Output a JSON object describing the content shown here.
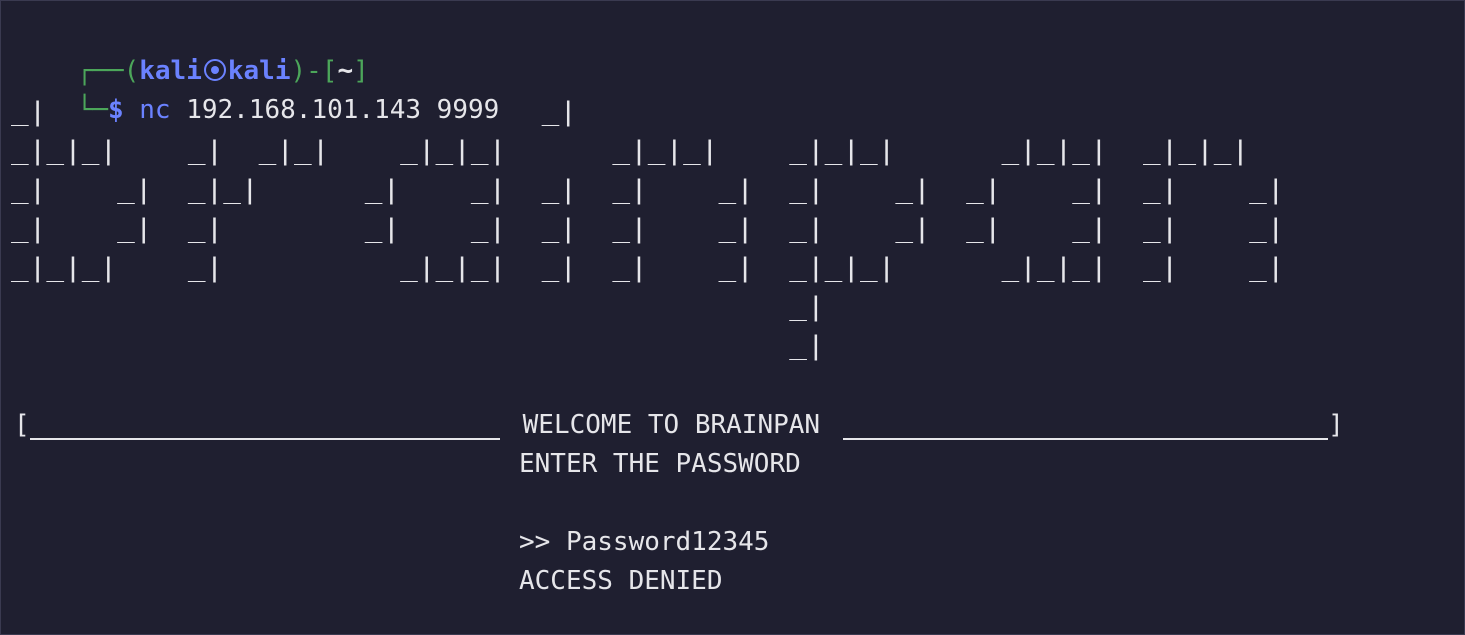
{
  "prompt": {
    "frame_top": "┌──(",
    "user": "kali",
    "host": "kali",
    "dir_open": ")-[",
    "dir": "~",
    "dir_close": "]",
    "frame_bottom": "└─",
    "symbol": "$",
    "command": "nc",
    "args": "192.168.101.143 9999",
    "icon": "kali-skull-icon"
  },
  "banner": {
    "ascii_art": "_|                            _|\n_|_|_|    _|  _|_|    _|_|_|      _|_|_|    _|_|_|      _|_|_|  _|_|_|\n_|    _|  _|_|      _|    _|  _|  _|    _|  _|    _|  _|    _|  _|    _|\n_|    _|  _|        _|    _|  _|  _|    _|  _|    _|  _|    _|  _|    _|\n_|_|_|    _|          _|_|_|  _|  _|    _|  _|_|_|      _|_|_|  _|    _|\n                                            _|\n                                            _|",
    "bracket_left": "[",
    "welcome": "WELCOME TO BRAINPAN",
    "bracket_right": "]"
  },
  "session": {
    "enter_password": "ENTER THE PASSWORD",
    "input_line": ">> Password12345",
    "result": "ACCESS DENIED"
  }
}
